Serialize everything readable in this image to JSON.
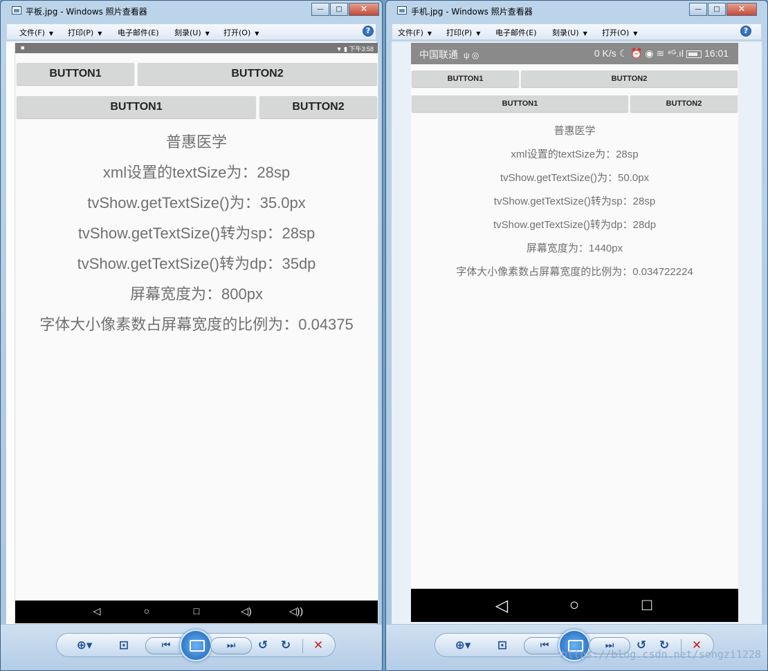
{
  "tablet_window": {
    "title": "平板.jpg - Windows 照片查看器",
    "controls": {
      "minimize": "—",
      "maximize": "□",
      "close": "✕"
    },
    "menu": [
      "文件(F)",
      "打印(P)",
      "电子邮件(E)",
      "刻录(U)",
      "打开(O)"
    ],
    "help": "?",
    "status_bar": {
      "left": "■",
      "right": "▼ ▮ 下午3:58"
    },
    "row1": {
      "button1": "BUTTON1",
      "button2": "BUTTON2"
    },
    "row2": {
      "button1": "BUTTON1",
      "button2": "BUTTON2"
    },
    "lines": [
      "普惠医学",
      "xml设置的textSize为：28sp",
      "tvShow.getTextSize()为：35.0px",
      "tvShow.getTextSize()转为sp：28sp",
      "tvShow.getTextSize()转为dp：35dp",
      "屏幕宽度为：800px",
      "字体大小像素数占屏幕宽度的比例为：0.04375"
    ],
    "nav": {
      "back": "◁",
      "home": "○",
      "recents": "□",
      "vol_down": "◁)",
      "vol_up": "◁))"
    }
  },
  "phone_window": {
    "title": "手机.jpg - Windows 照片查看器",
    "controls": {
      "minimize": "—",
      "maximize": "□",
      "close": "✕"
    },
    "menu": [
      "文件(F)",
      "打印(P)",
      "电子邮件(E)",
      "刻录(U)",
      "打开(O)"
    ],
    "help": "?",
    "status_bar": {
      "carrier": "中国联通",
      "icons_left": "ψ ◎",
      "right_text": "0 K/s ☾ ⏰ ◉ ≋ ⁴ᴳ.ıl",
      "time": "16:01"
    },
    "row1": {
      "button1": "BUTTON1",
      "button2": "BUTTON2"
    },
    "row2": {
      "button1": "BUTTON1",
      "button2": "BUTTON2"
    },
    "lines": [
      "普惠医学",
      "xml设置的textSize为：28sp",
      "tvShow.getTextSize()为：50.0px",
      "tvShow.getTextSize()转为sp：28sp",
      "tvShow.getTextSize()转为dp：28dp",
      "屏幕宽度为：1440px",
      "字体大小像素数占屏幕宽度的比例为：0.034722224"
    ],
    "nav": {
      "back": "◁",
      "home": "○",
      "recents": "□"
    }
  },
  "viewer_toolbar": {
    "zoom": "⊕▾",
    "fit": "⊡",
    "prev": "⏮",
    "next": "⏭",
    "rotate_ccw": "↺",
    "rotate_cw": "↻",
    "delete": "✕"
  },
  "watermark": "https://blog.csdn.net/songzi1228"
}
